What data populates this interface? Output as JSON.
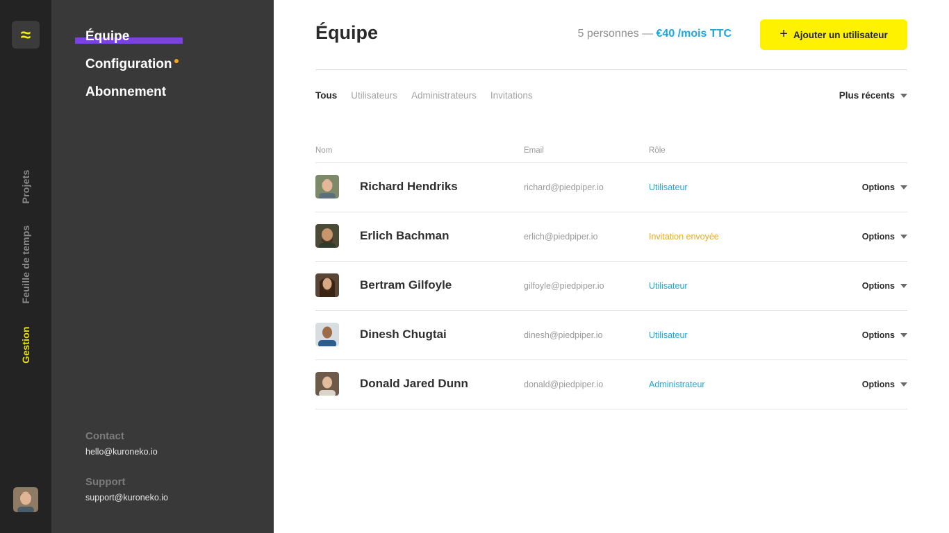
{
  "rail": {
    "logo_glyph": "≈",
    "nav": [
      {
        "label": "Projets",
        "active": false
      },
      {
        "label": "Feuille de temps",
        "active": false
      },
      {
        "label": "Gestion",
        "active": true
      }
    ]
  },
  "sidebar": {
    "items": [
      {
        "label": "Équipe",
        "active": true
      },
      {
        "label": "Configuration",
        "has_notification": true
      },
      {
        "label": "Abonnement"
      }
    ],
    "contact": {
      "title": "Contact",
      "value": "hello@kuroneko.io"
    },
    "support": {
      "title": "Support",
      "value": "support@kuroneko.io"
    }
  },
  "main": {
    "title": "Équipe",
    "summary": {
      "count": "5 personnes",
      "separator": "—",
      "price": "€40 /mois TTC"
    },
    "add_button": "Ajouter un utilisateur",
    "tabs": [
      {
        "label": "Tous",
        "active": true
      },
      {
        "label": "Utilisateurs"
      },
      {
        "label": "Administrateurs"
      },
      {
        "label": "Invitations"
      }
    ],
    "sort": "Plus récents",
    "columns": {
      "name": "Nom",
      "email": "Email",
      "role": "Rôle"
    },
    "rows": [
      {
        "name": "Richard Hendriks",
        "email": "richard@piedpiper.io",
        "role": "Utilisateur",
        "role_color": "#1ba8e0",
        "options": "Options"
      },
      {
        "name": "Erlich Bachman",
        "email": "erlich@piedpiper.io",
        "role": "Invitation envoyée",
        "role_color": "#f0a81c",
        "options": "Options"
      },
      {
        "name": "Bertram Gilfoyle",
        "email": "gilfoyle@piedpiper.io",
        "role": "Utilisateur",
        "role_color": "#1ba8e0",
        "options": "Options"
      },
      {
        "name": "Dinesh Chugtai",
        "email": "dinesh@piedpiper.io",
        "role": "Utilisateur",
        "role_color": "#1ba8e0",
        "options": "Options"
      },
      {
        "name": "Donald Jared Dunn",
        "email": "donald@piedpiper.io",
        "role": "Administrateur",
        "role_color": "#1ba8e0",
        "options": "Options"
      }
    ]
  },
  "colors": {
    "accent_yellow": "#fff200",
    "rail_active": "#e8e400",
    "underline_purple": "#7b42e0",
    "role_blue": "#1ba8e0",
    "role_orange": "#f0a81c"
  }
}
